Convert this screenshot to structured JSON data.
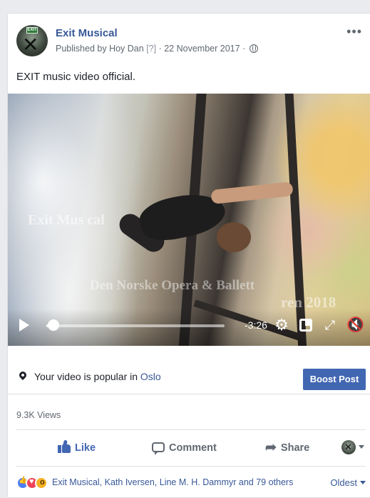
{
  "post": {
    "page_name": "Exit Musical",
    "avatar_badge": "EXIT",
    "published_prefix": "Published by",
    "publisher": "Hoy Dan",
    "publisher_hint": "[?]",
    "date": "22 November 2017",
    "separator": "·",
    "more_label": "•••",
    "caption": "EXIT music video official."
  },
  "video": {
    "overlay_line_1": "Exit Mus  cal",
    "overlay_line_2": "Den  Norske Opera & Ballett",
    "overlay_line_3": "ren 2018",
    "time_remaining": "-3:26",
    "progress": 0.03,
    "icons": {
      "play": "play-icon",
      "settings": "gear-icon",
      "pip": "picture-in-picture-icon",
      "expand": "fullscreen-icon",
      "mute": "mute-icon"
    },
    "gear_glyph": "⚙",
    "expand_glyph": "⤢",
    "mute_glyph": "🔇"
  },
  "popularity": {
    "text": "Your video is popular in",
    "city": "Oslo",
    "boost_label": "Boost Post"
  },
  "stats": {
    "views": "9.3K Views"
  },
  "actions": {
    "like": "Like",
    "comment": "Comment",
    "share": "Share",
    "share_glyph": "➦"
  },
  "reactions": {
    "types": [
      "like",
      "love",
      "wow"
    ],
    "summary": "Exit Musical, Kath Iversen, Line M. H. Dammyr and 79 others",
    "sort_label": "Oldest"
  },
  "colors": {
    "link_blue": "#385898",
    "button_blue": "#4267b2",
    "text_dark": "#1d2129",
    "text_gray": "#606770",
    "background": "#e9ebee"
  }
}
